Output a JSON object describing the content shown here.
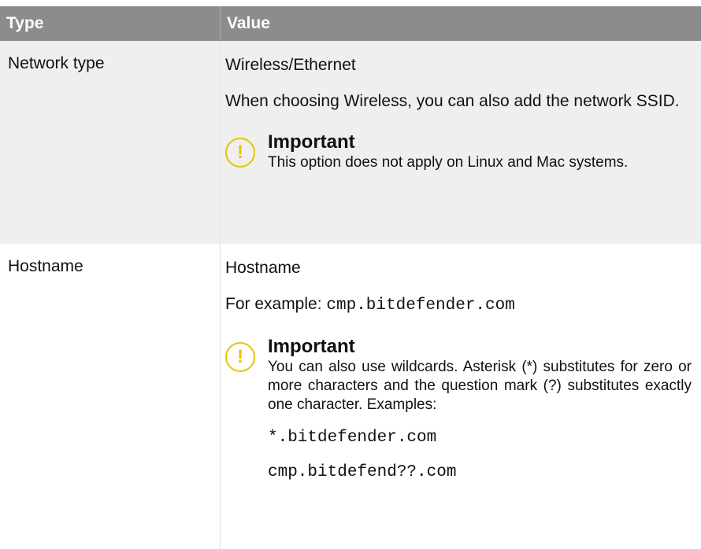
{
  "table": {
    "headers": {
      "type": "Type",
      "value": "Value"
    },
    "rows": [
      {
        "type": "Network type",
        "value_title": "Wireless/Ethernet",
        "value_text": "When choosing Wireless, you can also add the network SSID.",
        "important": {
          "title": "Important",
          "text": "This option does not apply on Linux and Mac systems."
        }
      },
      {
        "type": "Hostname",
        "value_title": "Hostname",
        "example_label": "For example:",
        "example_code": "cmp.bitdefender.com",
        "important": {
          "title": "Important",
          "text": "You can also use wildcards. Asterisk (*) substitutes for zero or more characters and the question mark (?) substitutes exactly one character. Examples:",
          "examples": [
            "*.bitdefender.com",
            "cmp.bitdefend??.com"
          ]
        }
      }
    ]
  },
  "icons": {
    "important": "exclamation-icon"
  },
  "colors": {
    "header_bg": "#8c8c8c",
    "shaded_row": "#efefef",
    "important_accent": "#e7c400"
  }
}
